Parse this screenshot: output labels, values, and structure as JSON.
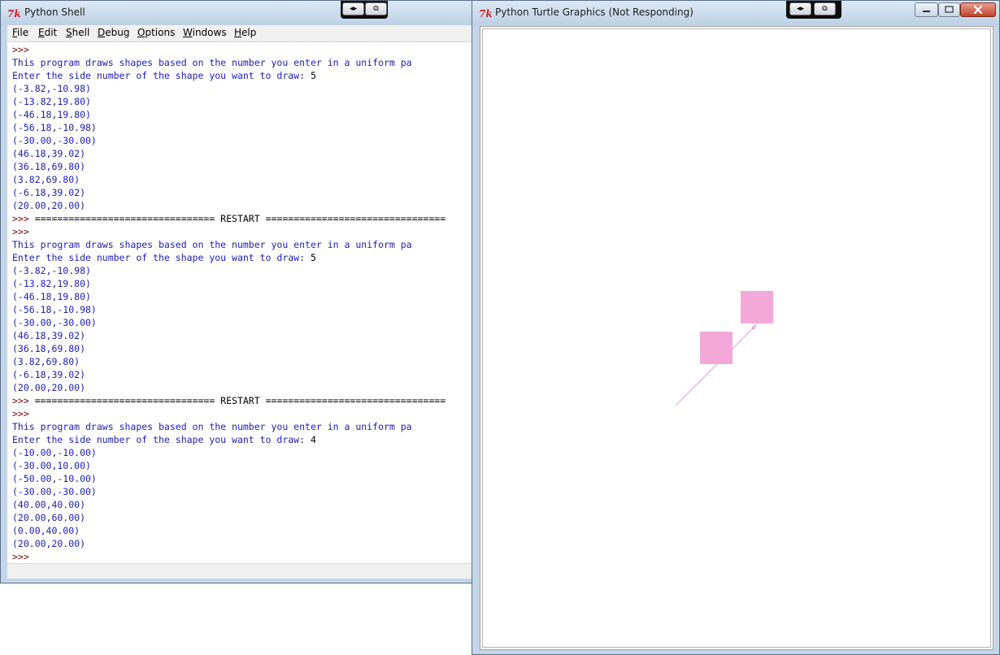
{
  "shell": {
    "title": "Python Shell",
    "menu": [
      {
        "label": "File",
        "key": "F",
        "rest": "ile"
      },
      {
        "label": "Edit",
        "key": "E",
        "rest": "dit"
      },
      {
        "label": "Shell",
        "key": "S",
        "rest": "hell"
      },
      {
        "label": "Debug",
        "key": "D",
        "rest": "ebug"
      },
      {
        "label": "Options",
        "key": "O",
        "rest": "ptions"
      },
      {
        "label": "Windows",
        "key": "W",
        "rest": "indows"
      },
      {
        "label": "Help",
        "key": "H",
        "rest": "elp"
      }
    ],
    "lines": [
      {
        "kind": "prompt",
        "text": ">>>"
      },
      {
        "kind": "out",
        "text": "This program draws shapes based on the number you enter in a uniform pa"
      },
      {
        "kind": "out",
        "text": "Enter the side number of the shape you want to draw: ",
        "input": "5"
      },
      {
        "kind": "out",
        "text": "(-3.82,-10.98)"
      },
      {
        "kind": "out",
        "text": "(-13.82,19.80)"
      },
      {
        "kind": "out",
        "text": "(-46.18,19.80)"
      },
      {
        "kind": "out",
        "text": "(-56.18,-10.98)"
      },
      {
        "kind": "out",
        "text": "(-30.00,-30.00)"
      },
      {
        "kind": "out",
        "text": "(46.18,39.02)"
      },
      {
        "kind": "out",
        "text": "(36.18,69.80)"
      },
      {
        "kind": "out",
        "text": "(3.82,69.80)"
      },
      {
        "kind": "out",
        "text": "(-6.18,39.02)"
      },
      {
        "kind": "out",
        "text": "(20.00,20.00)"
      },
      {
        "kind": "restart",
        "prefix": ">>> ",
        "text": "================================ RESTART ================================"
      },
      {
        "kind": "prompt",
        "text": ">>>"
      },
      {
        "kind": "out",
        "text": "This program draws shapes based on the number you enter in a uniform pa"
      },
      {
        "kind": "out",
        "text": "Enter the side number of the shape you want to draw: ",
        "input": "5"
      },
      {
        "kind": "out",
        "text": "(-3.82,-10.98)"
      },
      {
        "kind": "out",
        "text": "(-13.82,19.80)"
      },
      {
        "kind": "out",
        "text": "(-46.18,19.80)"
      },
      {
        "kind": "out",
        "text": "(-56.18,-10.98)"
      },
      {
        "kind": "out",
        "text": "(-30.00,-30.00)"
      },
      {
        "kind": "out",
        "text": "(46.18,39.02)"
      },
      {
        "kind": "out",
        "text": "(36.18,69.80)"
      },
      {
        "kind": "out",
        "text": "(3.82,69.80)"
      },
      {
        "kind": "out",
        "text": "(-6.18,39.02)"
      },
      {
        "kind": "out",
        "text": "(20.00,20.00)"
      },
      {
        "kind": "restart",
        "prefix": ">>> ",
        "text": "================================ RESTART ================================"
      },
      {
        "kind": "prompt",
        "text": ">>>"
      },
      {
        "kind": "out",
        "text": "This program draws shapes based on the number you enter in a uniform pa"
      },
      {
        "kind": "out",
        "text": "Enter the side number of the shape you want to draw: ",
        "input": "4"
      },
      {
        "kind": "out",
        "text": "(-10.00,-10.00)"
      },
      {
        "kind": "out",
        "text": "(-30.00,10.00)"
      },
      {
        "kind": "out",
        "text": "(-50.00,-10.00)"
      },
      {
        "kind": "out",
        "text": "(-30.00,-30.00)"
      },
      {
        "kind": "out",
        "text": "(40.00,40.00)"
      },
      {
        "kind": "out",
        "text": "(20.00,60.00)"
      },
      {
        "kind": "out",
        "text": "(0.00,40.00)"
      },
      {
        "kind": "out",
        "text": "(20.00,20.00)"
      },
      {
        "kind": "prompt",
        "text": ">>>"
      }
    ]
  },
  "turtle": {
    "title": "Python Turtle Graphics (Not Responding)",
    "shape_color": "#f4a8d8",
    "line_color": "#e2a0d0"
  },
  "icons": {
    "app": "tk-feather-icon",
    "minimize": "minimize-icon",
    "maximize": "maximize-icon",
    "close": "close-icon"
  }
}
